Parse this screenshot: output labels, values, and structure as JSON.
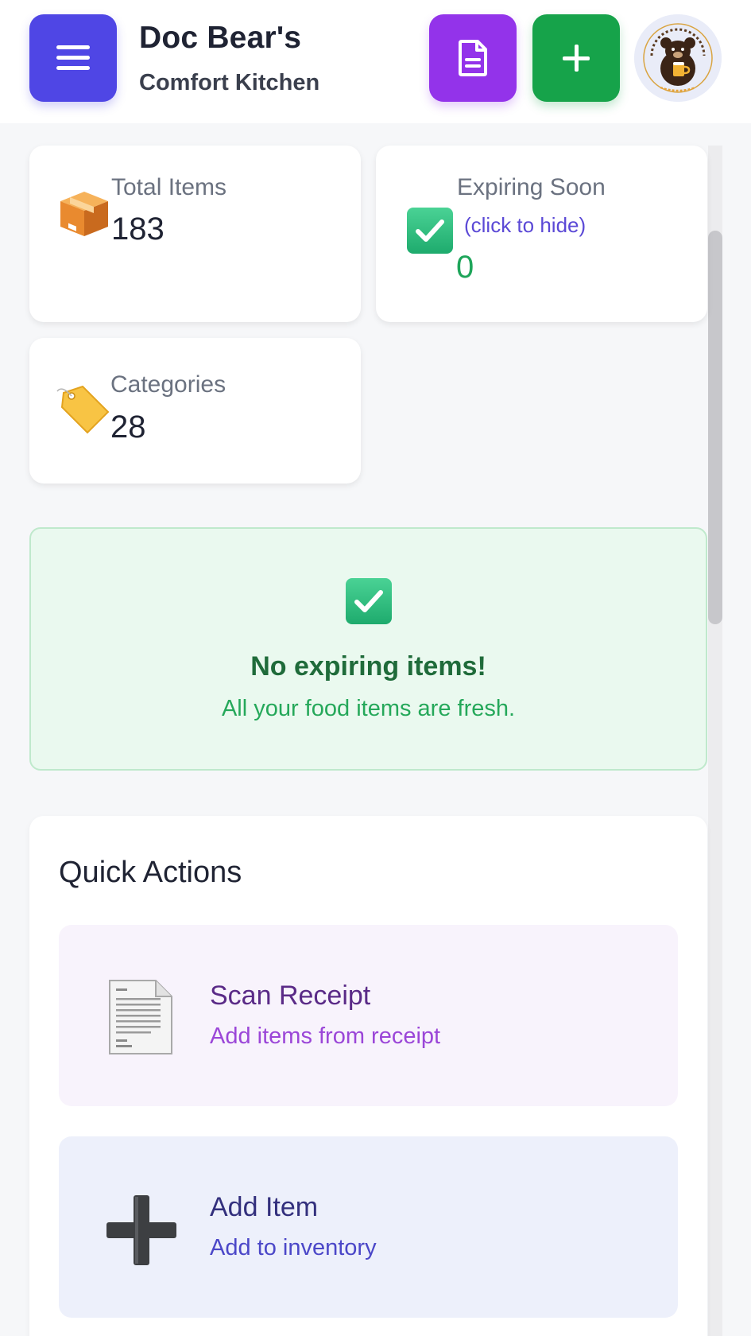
{
  "header": {
    "title": "Doc Bear's",
    "subtitle": "Comfort Kitchen",
    "menu_icon": "hamburger-menu-icon",
    "receipt_button_icon": "document-icon",
    "add_button_icon": "plus-icon",
    "avatar_logo_text": "Food Care by Doc Bear — What Ales You?",
    "colors": {
      "menu": "#4f46e5",
      "receipt": "#9333ea",
      "add": "#16a34a"
    }
  },
  "stats": {
    "total_items": {
      "label": "Total Items",
      "value": "183",
      "icon": "package-icon"
    },
    "expiring_soon": {
      "label": "Expiring Soon",
      "hint": "(click to hide)",
      "value": "0",
      "icon": "check-mark-icon"
    },
    "categories": {
      "label": "Categories",
      "value": "28",
      "icon": "tag-icon"
    }
  },
  "notice": {
    "icon": "check-mark-icon",
    "title": "No expiring items!",
    "message": "All your food items are fresh."
  },
  "quick_actions": {
    "title": "Quick Actions",
    "items": [
      {
        "title": "Scan Receipt",
        "subtitle": "Add items from receipt",
        "icon": "receipt-icon"
      },
      {
        "title": "Add Item",
        "subtitle": "Add to inventory",
        "icon": "plus-icon"
      }
    ]
  }
}
